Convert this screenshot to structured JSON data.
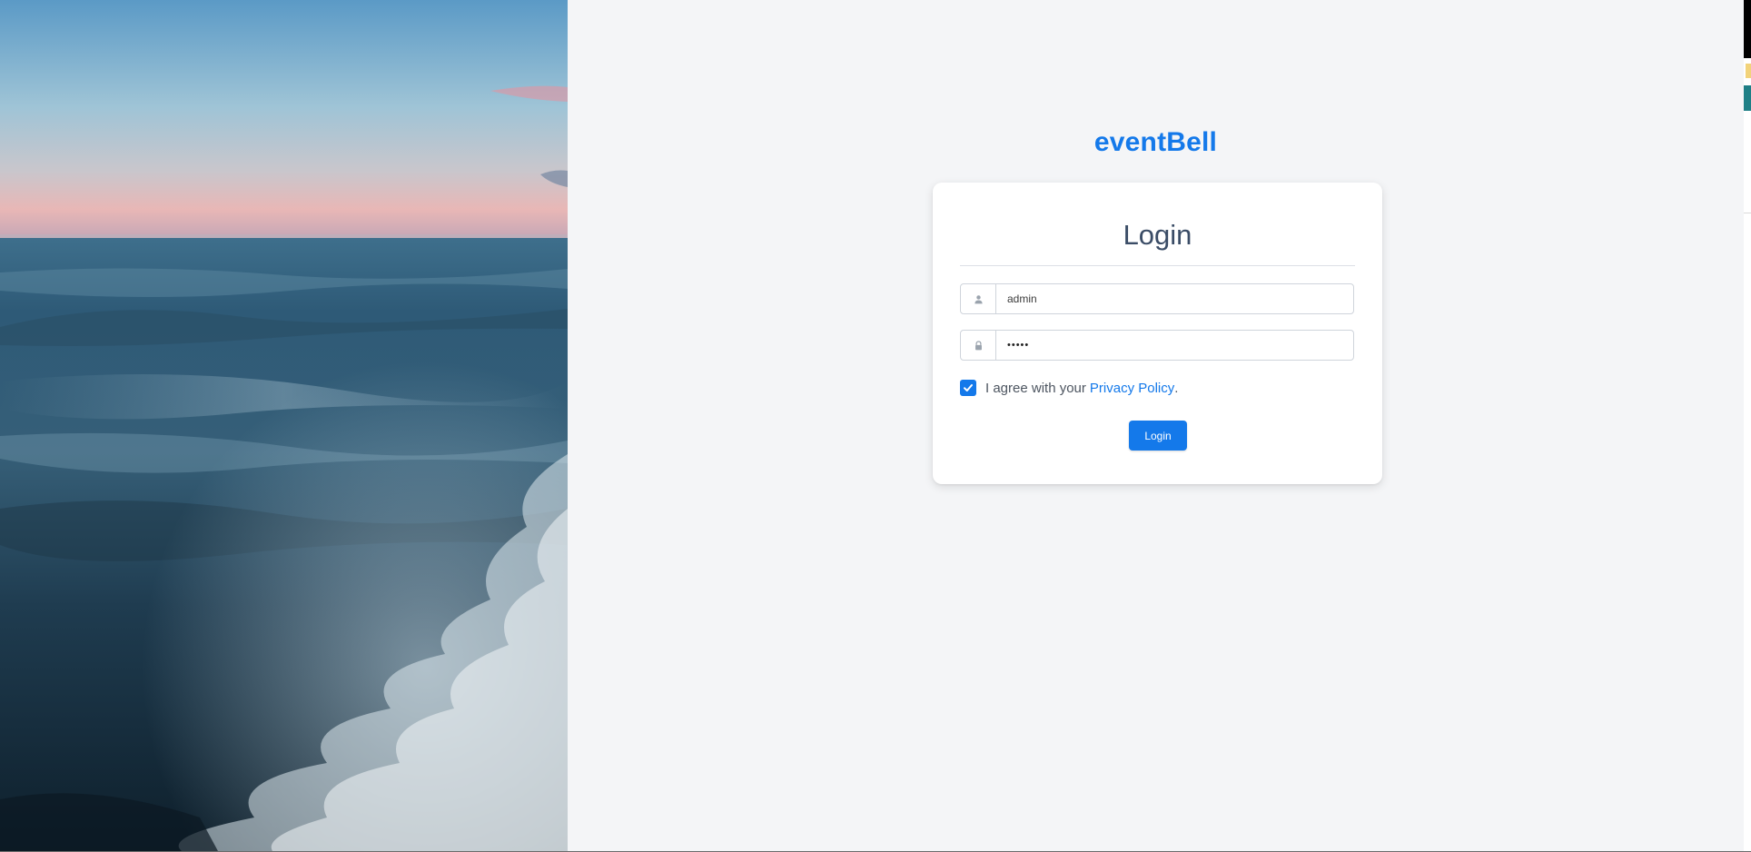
{
  "brand": {
    "name": "eventBell",
    "color": "#1479ea"
  },
  "login_card": {
    "title": "Login",
    "username": {
      "value": "admin",
      "icon": "user-icon"
    },
    "password": {
      "masked_value": "•••••",
      "icon": "lock-icon"
    },
    "agree": {
      "checked": true,
      "text": "I agree with your",
      "link_text": "Privacy Policy",
      "trailing": "."
    },
    "submit_label": "Login"
  },
  "background_image": {
    "subject": "ocean-waves-at-dusk"
  },
  "colors": {
    "accent": "#1479ea",
    "page_bg": "#f4f5f7",
    "card_bg": "#ffffff",
    "title_text": "#3a4c66"
  }
}
